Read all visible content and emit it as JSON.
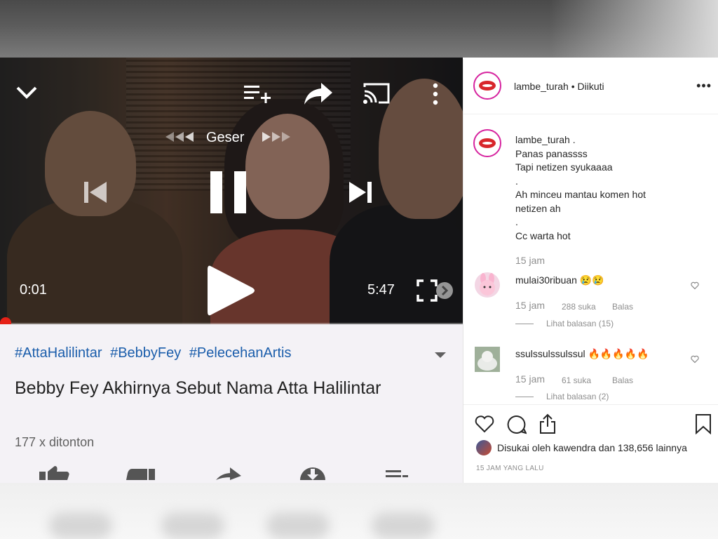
{
  "player": {
    "swipe_hint": "Geser",
    "current_time": "0:01",
    "duration": "5:47",
    "progress_fraction": 0.01
  },
  "video": {
    "hashtags": [
      "#AttaHalilintar",
      "#BebbyFey",
      "#PelecehanArtis"
    ],
    "title": "Bebby Fey Akhirnya Sebut Nama Atta Halilintar",
    "views": "177 x ditonton"
  },
  "icons": {
    "collapse": "chevron-down-icon",
    "add_to_queue": "playlist-add-icon",
    "share": "share-arrow-icon",
    "cast": "cast-icon",
    "more": "more-vert-icon",
    "prev": "skip-previous-icon",
    "pause": "pause-icon",
    "next": "skip-next-icon",
    "play": "play-icon",
    "fullscreen": "fullscreen-icon"
  },
  "instagram": {
    "header": {
      "username": "lambe_turah",
      "separator": " • ",
      "follow_status": "Diikuti",
      "more": "•••"
    },
    "caption": {
      "username": "lambe_turah",
      "lines": [
        ".",
        "Panas panassss",
        "Tapi netizen syukaaaa",
        ".",
        "Ah minceu mantau komen hot",
        "netizen ah",
        ".",
        "Cc warta hot"
      ],
      "time": "15 jam"
    },
    "comments": [
      {
        "username": "mulai30ribuan",
        "text": "😢😢",
        "time": "15 jam",
        "likes": "288 suka",
        "reply": "Balas",
        "view_replies": "Lihat balasan (15)"
      },
      {
        "username": "ssulssulssulssul",
        "text": "🔥🔥🔥🔥🔥",
        "time": "15 jam",
        "likes": "61 suka",
        "reply": "Balas",
        "view_replies": "Lihat balasan (2)"
      }
    ],
    "liked_by": "Disukai oleh kawendra dan 138,656 lainnya",
    "posted": "15 JAM YANG LALU"
  },
  "colors": {
    "hashtag": "#1a5dab",
    "progress": "#e62117",
    "ig_text": "#262626",
    "ig_meta": "#8e8e8e"
  }
}
